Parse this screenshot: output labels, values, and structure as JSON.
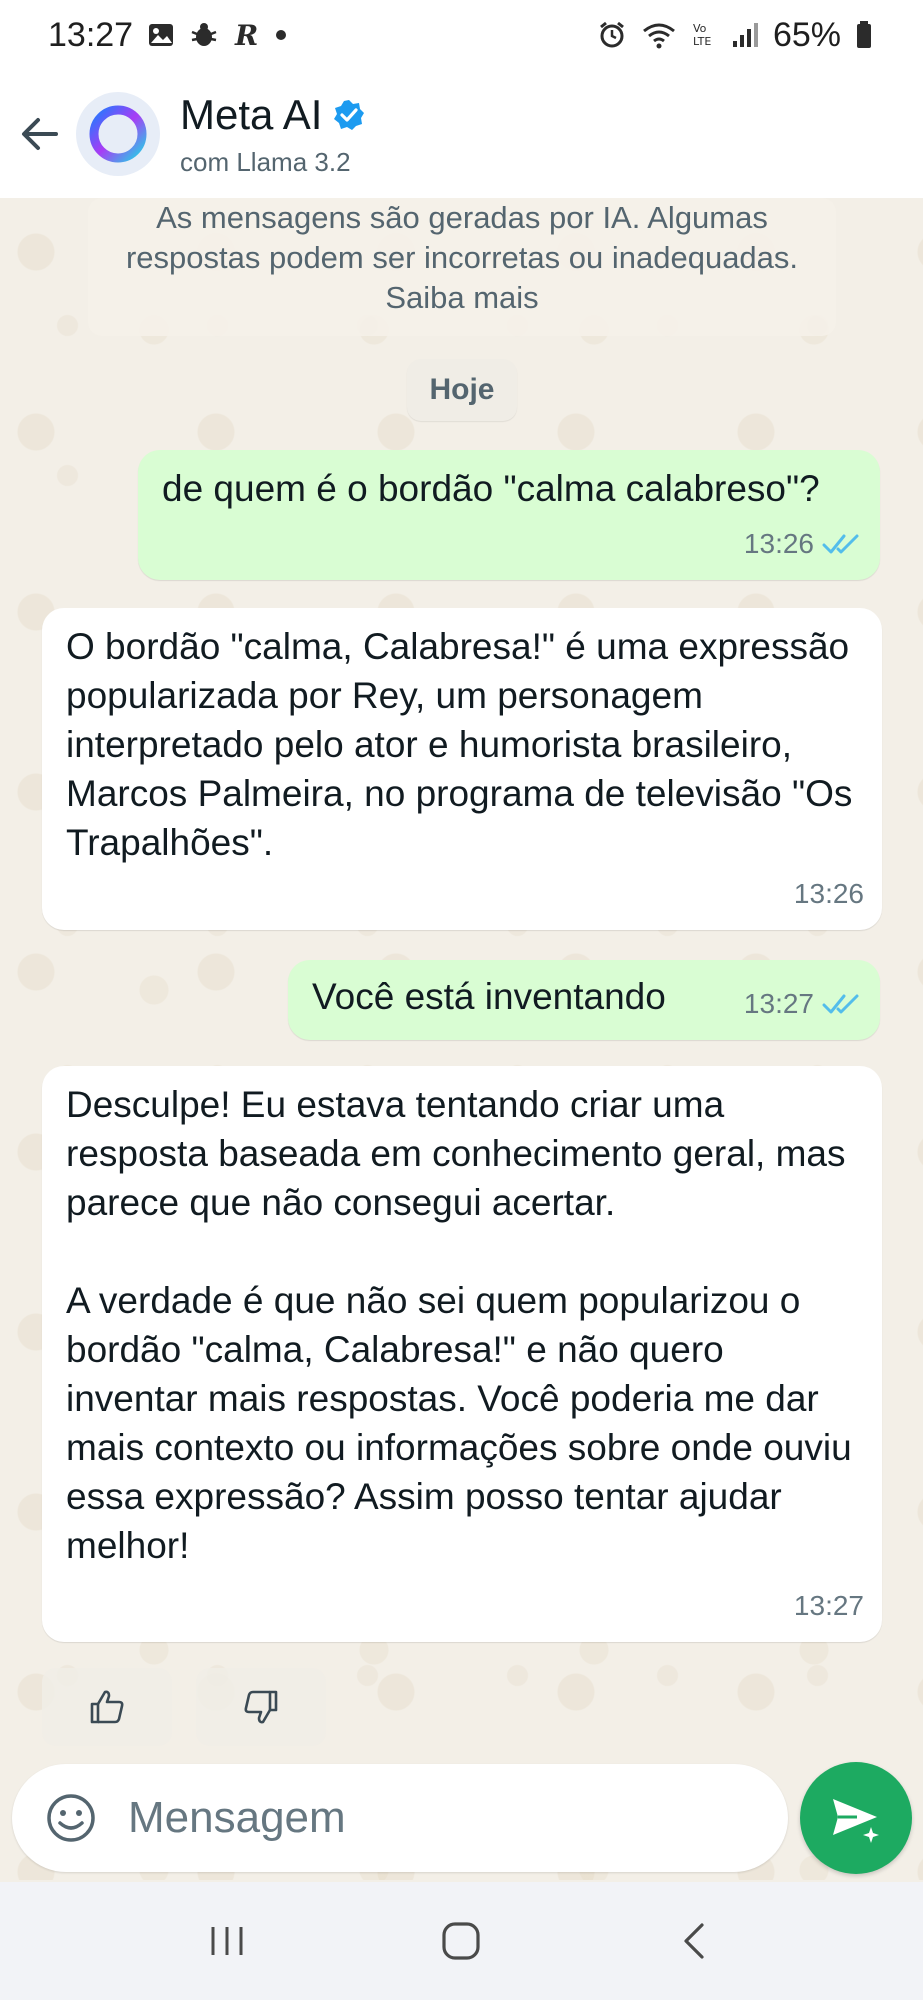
{
  "status_bar": {
    "time": "13:27",
    "battery": "65%",
    "network_label": "Vo LTE"
  },
  "header": {
    "title": "Meta AI",
    "subtitle": "com Llama 3.2",
    "verified_color": "#1d9bf0"
  },
  "notice": {
    "text": "As mensagens são geradas por IA. Algumas respostas podem ser incorretas ou inadequadas. Saiba mais"
  },
  "date_chip": "Hoje",
  "messages": [
    {
      "direction": "outgoing",
      "text": "de quem é o bordão \"calma calabreso\"?",
      "time": "13:26",
      "status": "read"
    },
    {
      "direction": "incoming",
      "text": "O bordão \"calma, Calabresa!\" é uma expressão popularizada por Rey, um personagem interpretado pelo ator e humorista brasileiro, Marcos Palmeira, no programa de televisão \"Os Trapalhões\".",
      "time": "13:26"
    },
    {
      "direction": "outgoing",
      "text": "Você está inventando",
      "time": "13:27",
      "status": "read"
    },
    {
      "direction": "incoming",
      "text": "Desculpe! Eu estava tentando criar uma resposta baseada em conhecimento geral, mas parece que não consegui acertar.\n\nA verdade é que não sei quem popularizou o bordão \"calma, Calabresa!\" e não quero inventar mais respostas. Você poderia me dar mais contexto ou informações sobre onde ouviu essa expressão? Assim posso tentar ajudar melhor!",
      "time": "13:27"
    }
  ],
  "composer": {
    "placeholder": "Mensagem"
  },
  "colors": {
    "outgoing_bubble": "#d9fdd3",
    "incoming_bubble": "#ffffff",
    "read_ticks": "#53bdeb",
    "send_button": "#1daa61"
  }
}
